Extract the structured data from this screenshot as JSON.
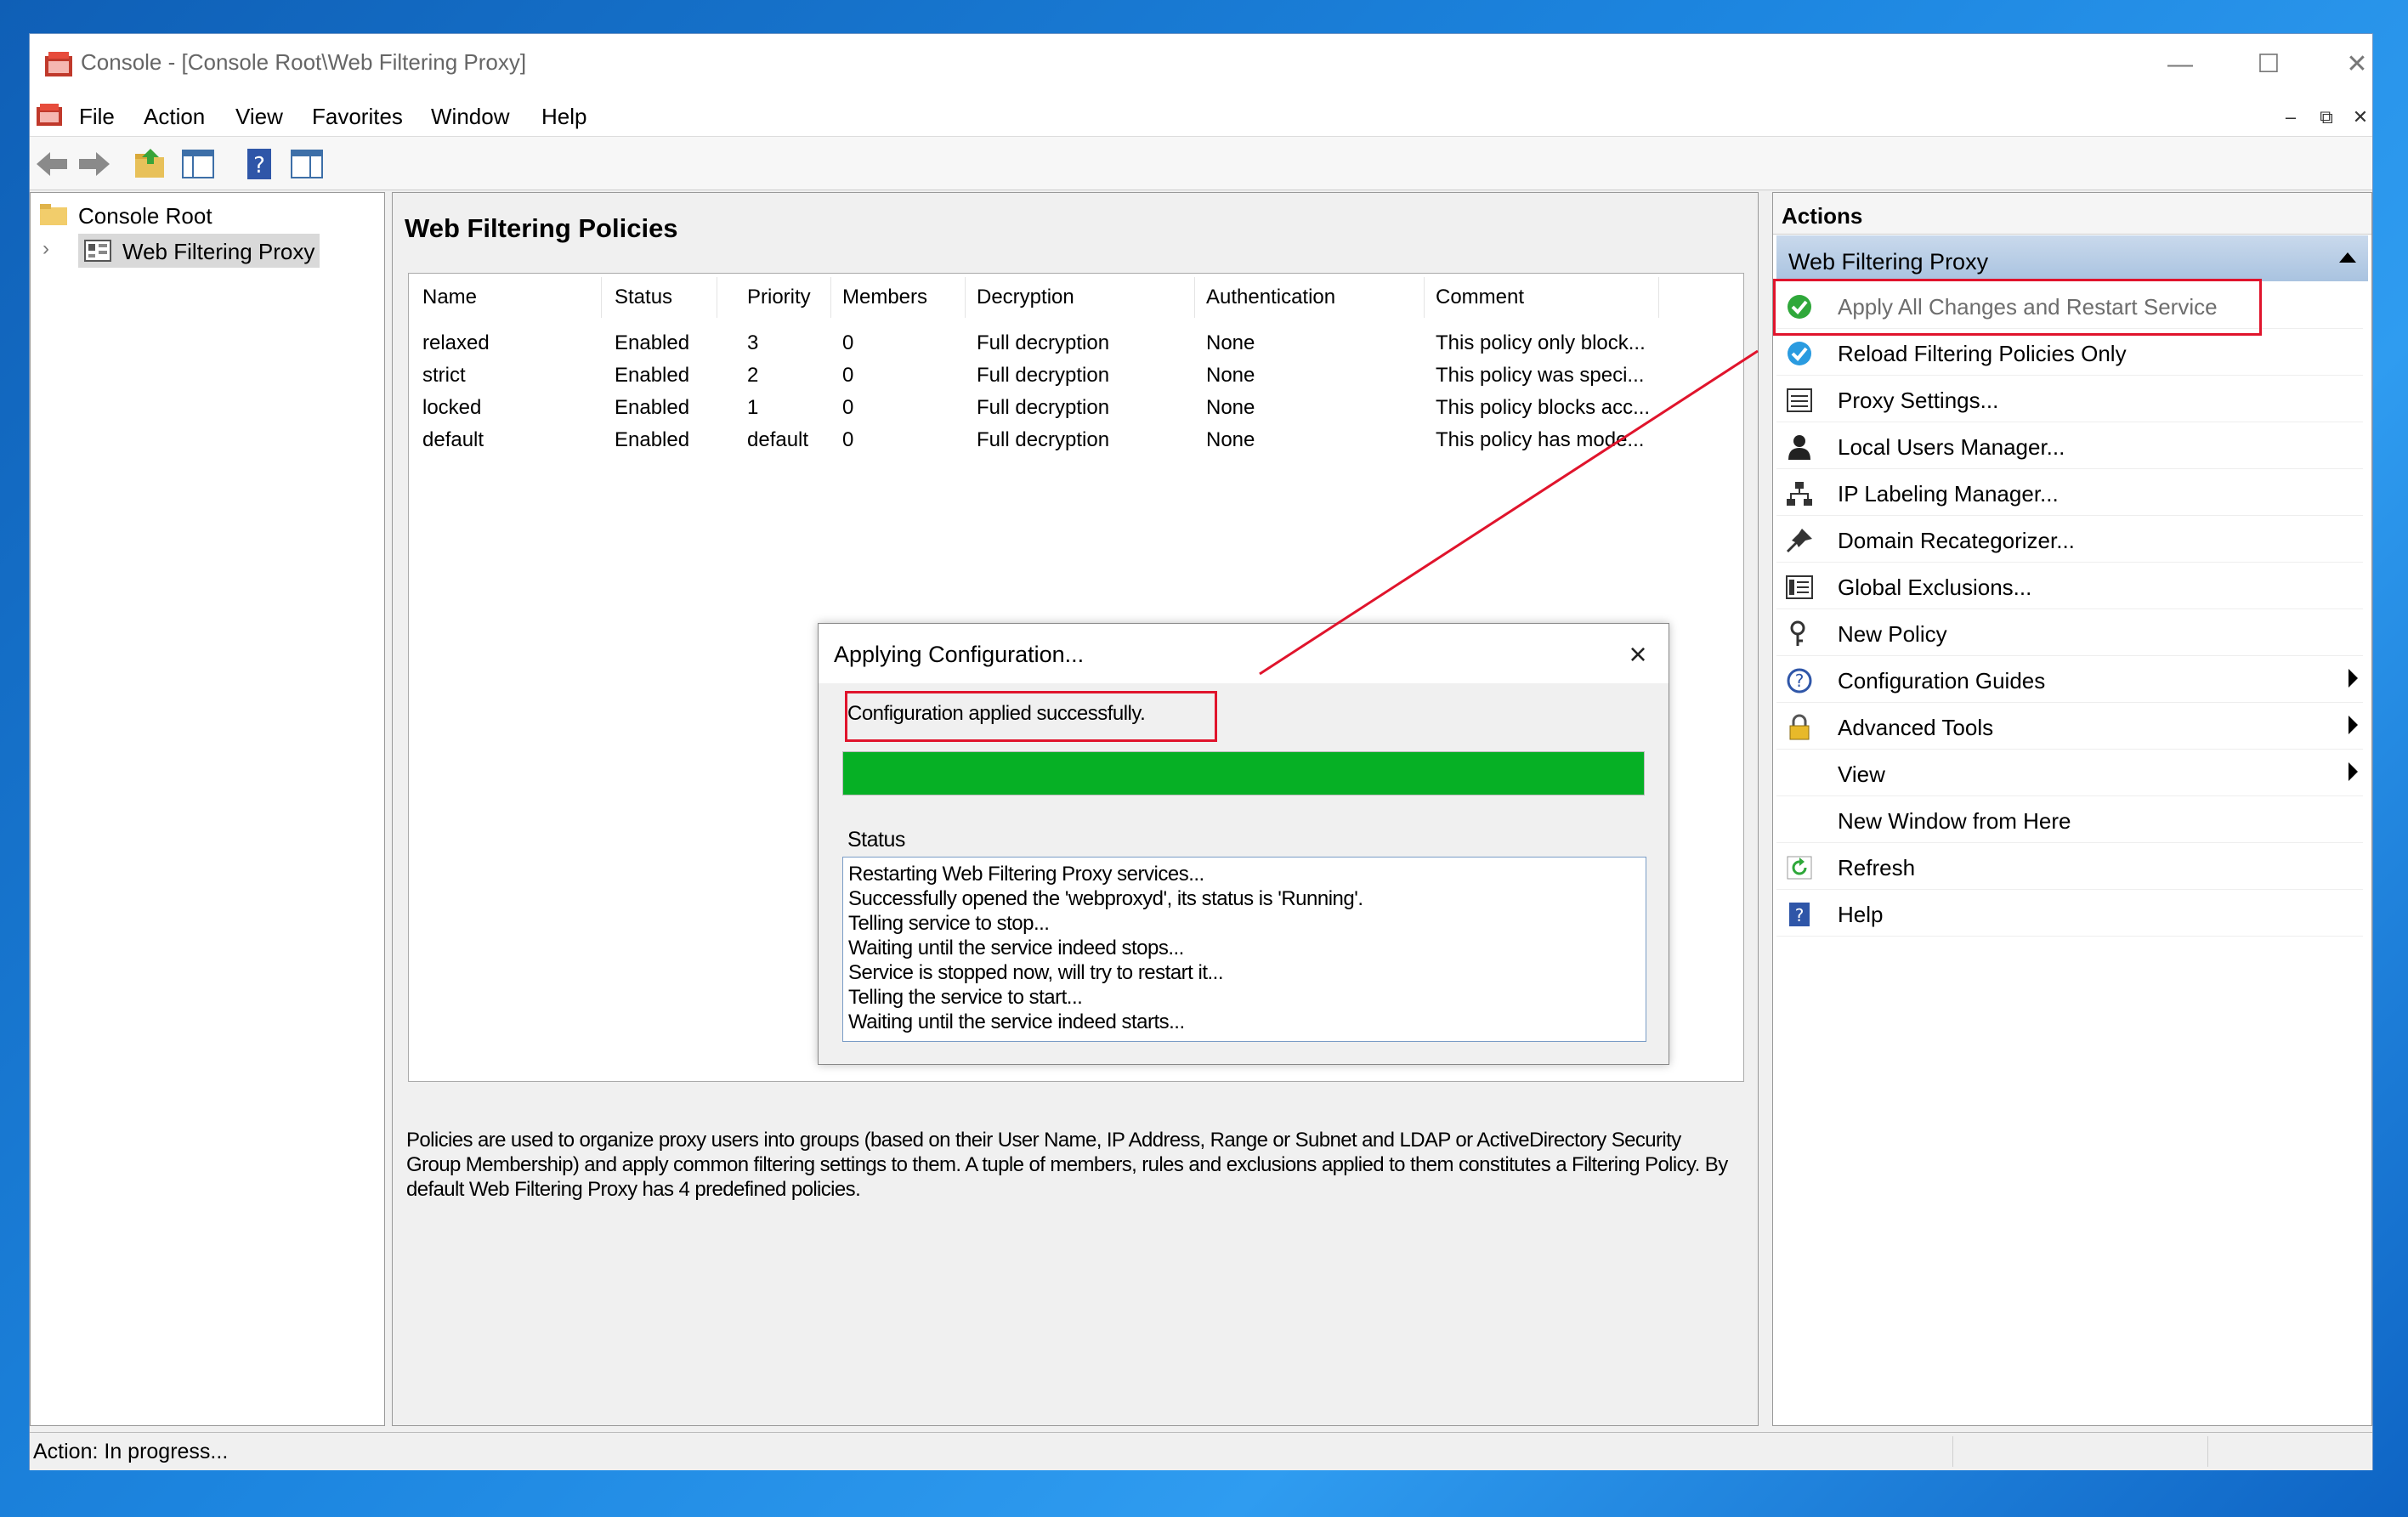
{
  "window": {
    "title": "Console - [Console Root\\Web Filtering Proxy]"
  },
  "menu": [
    "File",
    "Action",
    "View",
    "Favorites",
    "Window",
    "Help"
  ],
  "tree": {
    "root": "Console Root",
    "child": "Web Filtering Proxy"
  },
  "center": {
    "heading": "Web Filtering Policies",
    "columns": [
      "Name",
      "Status",
      "Priority",
      "Members",
      "Decryption",
      "Authentication",
      "Comment"
    ],
    "rows": [
      [
        "relaxed",
        "Enabled",
        "3",
        "0",
        "Full decryption",
        "None",
        "This policy only block..."
      ],
      [
        "strict",
        "Enabled",
        "2",
        "0",
        "Full decryption",
        "None",
        "This policy was speci..."
      ],
      [
        "locked",
        "Enabled",
        "1",
        "0",
        "Full decryption",
        "None",
        "This policy blocks acc..."
      ],
      [
        "default",
        "Enabled",
        "default",
        "0",
        "Full decryption",
        "None",
        "This policy has mode..."
      ]
    ],
    "description": "Policies are used to organize proxy users into groups (based on their User Name, IP Address, Range or Subnet and LDAP or ActiveDirectory Security Group Membership) and apply common filtering settings to them. A tuple of members, rules and exclusions applied to them constitutes a Filtering Policy. By default Web Filtering Proxy has 4 predefined policies."
  },
  "actions": {
    "title": "Actions",
    "group": "Web Filtering Proxy",
    "items": [
      {
        "label": "Apply All Changes and Restart Service",
        "icon": "green-check-icon"
      },
      {
        "label": "Reload Filtering Policies Only",
        "icon": "blue-check-icon"
      },
      {
        "label": "Proxy Settings...",
        "icon": "settings-list-icon"
      },
      {
        "label": "Local Users Manager...",
        "icon": "user-icon"
      },
      {
        "label": "IP Labeling Manager...",
        "icon": "network-icon"
      },
      {
        "label": "Domain Recategorizer...",
        "icon": "pin-icon"
      },
      {
        "label": "Global Exclusions...",
        "icon": "list-icon"
      },
      {
        "label": "New Policy",
        "icon": "policy-icon"
      },
      {
        "label": "Configuration Guides",
        "icon": "help-circle-icon"
      },
      {
        "label": "Advanced Tools",
        "icon": "lock-icon"
      },
      {
        "label": "View",
        "icon": ""
      },
      {
        "label": "New Window from Here",
        "icon": ""
      },
      {
        "label": "Refresh",
        "icon": "refresh-icon"
      },
      {
        "label": "Help",
        "icon": "help-icon"
      }
    ]
  },
  "dialog": {
    "title": "Applying Configuration...",
    "message": "Configuration applied successfully.",
    "progress": 1.0,
    "status_label": "Status",
    "log": [
      "Restarting Web Filtering Proxy services...",
      "Successfully opened the 'webproxyd', its status is 'Running'.",
      "Telling service to stop...",
      "Waiting until the service indeed stops...",
      "Service is stopped now, will try to restart it...",
      "Telling the service to start...",
      "Waiting until the service indeed starts..."
    ]
  },
  "statusbar": {
    "text": "Action:  In progress..."
  },
  "colors": {
    "progress": "#06b025",
    "highlight": "#e0142c",
    "group_header": "#b9cfe7"
  }
}
